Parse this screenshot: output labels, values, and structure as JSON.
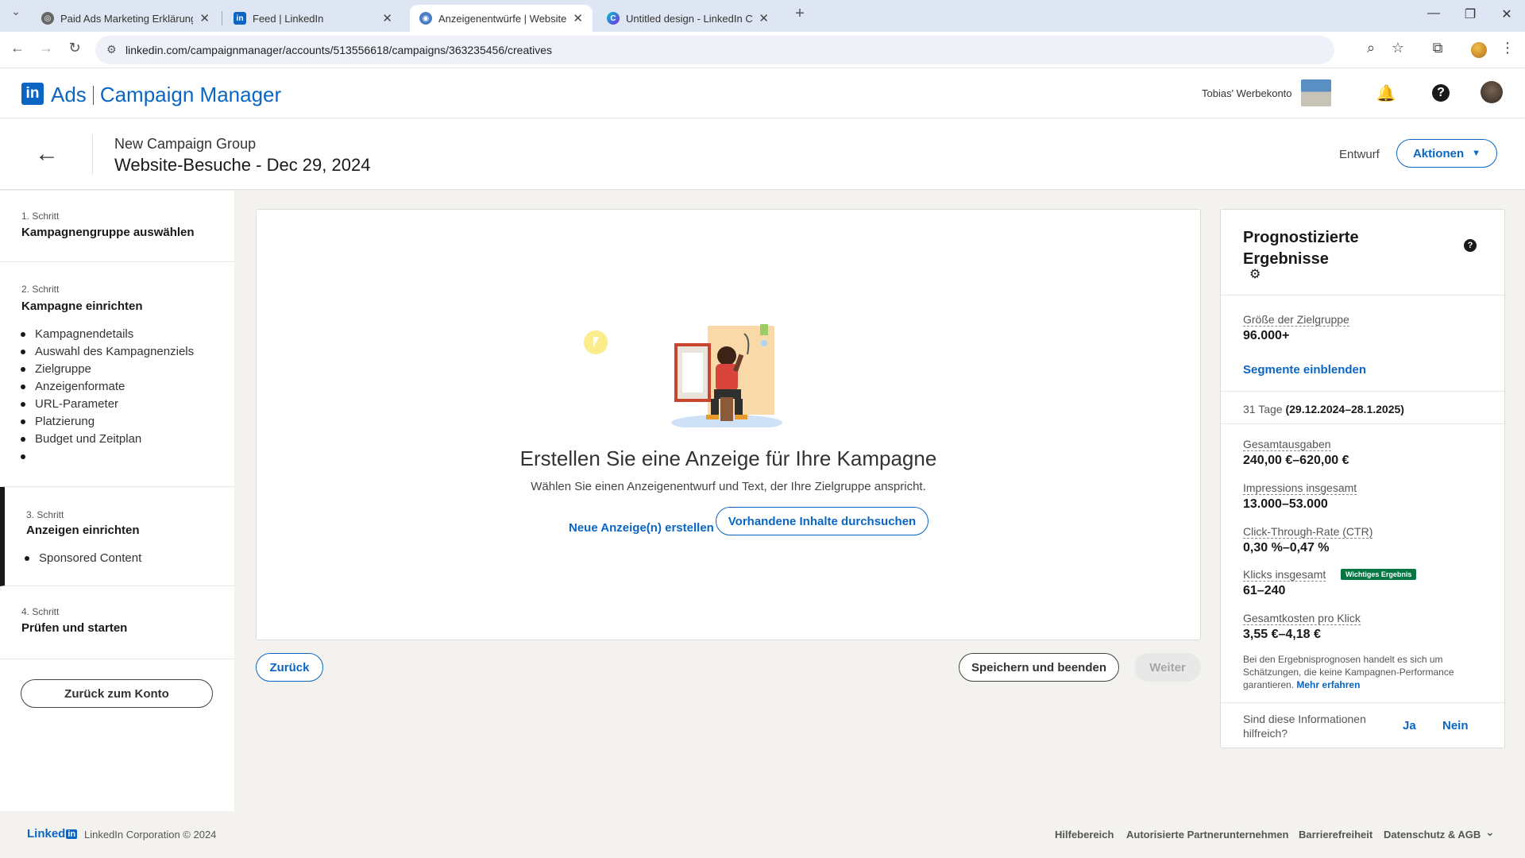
{
  "browser": {
    "tabs": [
      {
        "title": "Paid Ads Marketing Erklärung"
      },
      {
        "title": "Feed | LinkedIn"
      },
      {
        "title": "Anzeigenentwürfe | Website-Be"
      },
      {
        "title": "Untitled design - LinkedIn Caro"
      }
    ],
    "url": "linkedin.com/campaignmanager/accounts/513556618/campaigns/363235456/creatives"
  },
  "header": {
    "logo": "in",
    "ads": "Ads",
    "campaign_manager": "Campaign Manager",
    "account_name": "Tobias' Werbekonto"
  },
  "subheader": {
    "group": "New Campaign Group",
    "campaign": "Website-Besuche - Dec 29, 2024",
    "status": "Entwurf",
    "actions_label": "Aktionen"
  },
  "steps": [
    {
      "label": "1. Schritt",
      "title": "Kampagnengruppe auswählen"
    },
    {
      "label": "2. Schritt",
      "title": "Kampagne einrichten",
      "items": [
        "Kampagnendetails",
        "Auswahl des Kampagnenziels",
        "Zielgruppe",
        "Anzeigenformate",
        "URL-Parameter",
        "Platzierung",
        "Budget und Zeitplan",
        ""
      ]
    },
    {
      "label": "3. Schritt",
      "title": "Anzeigen einrichten",
      "items": [
        "Sponsored Content"
      ]
    },
    {
      "label": "4. Schritt",
      "title": "Prüfen und starten"
    }
  ],
  "back_to_account": "Zurück zum Konto",
  "main": {
    "title": "Erstellen Sie eine Anzeige für Ihre Kampagne",
    "subtitle": "Wählen Sie einen Anzeigenentwurf und Text, der Ihre Zielgruppe anspricht.",
    "new_ad": "Neue Anzeige(n) erstellen",
    "browse": "Vorhandene Inhalte durchsuchen"
  },
  "nav_buttons": {
    "back": "Zurück",
    "save": "Speichern und beenden",
    "next": "Weiter"
  },
  "forecast": {
    "title": "Prognostizierte Ergebnisse",
    "audience_label": "Größe der Zielgruppe",
    "audience_value": "96.000+",
    "segments_link": "Segmente einblenden",
    "period_days": "31 Tage",
    "period_range": "(29.12.2024–28.1.2025)",
    "metrics": [
      {
        "label": "Gesamtausgaben",
        "value": "240,00 €–620,00 €"
      },
      {
        "label": "Impressions insgesamt",
        "value": "13.000–53.000"
      },
      {
        "label": "Click-Through-Rate (CTR)",
        "value": "0,30 %–0,47 %"
      },
      {
        "label": "Klicks insgesamt",
        "value": "61–240"
      },
      {
        "label": "Gesamtkosten pro Klick",
        "value": "3,55 €–4,18 €"
      }
    ],
    "key_badge": "Wichtiges Ergebnis",
    "note": "Bei den Ergebnisprognosen handelt es sich um Schätzungen, die keine Kampagnen-Performance garantieren.",
    "more": "Mehr erfahren",
    "helpful_q": "Sind diese Informationen hilfreich?",
    "yes": "Ja",
    "no": "Nein"
  },
  "footer": {
    "brand": "Linked",
    "brand_in": "in",
    "copyright": "LinkedIn Corporation © 2024",
    "links": [
      "Hilfebereich",
      "Autorisierte Partnerunternehmen",
      "Barrierefreiheit",
      "Datenschutz & AGB"
    ]
  }
}
